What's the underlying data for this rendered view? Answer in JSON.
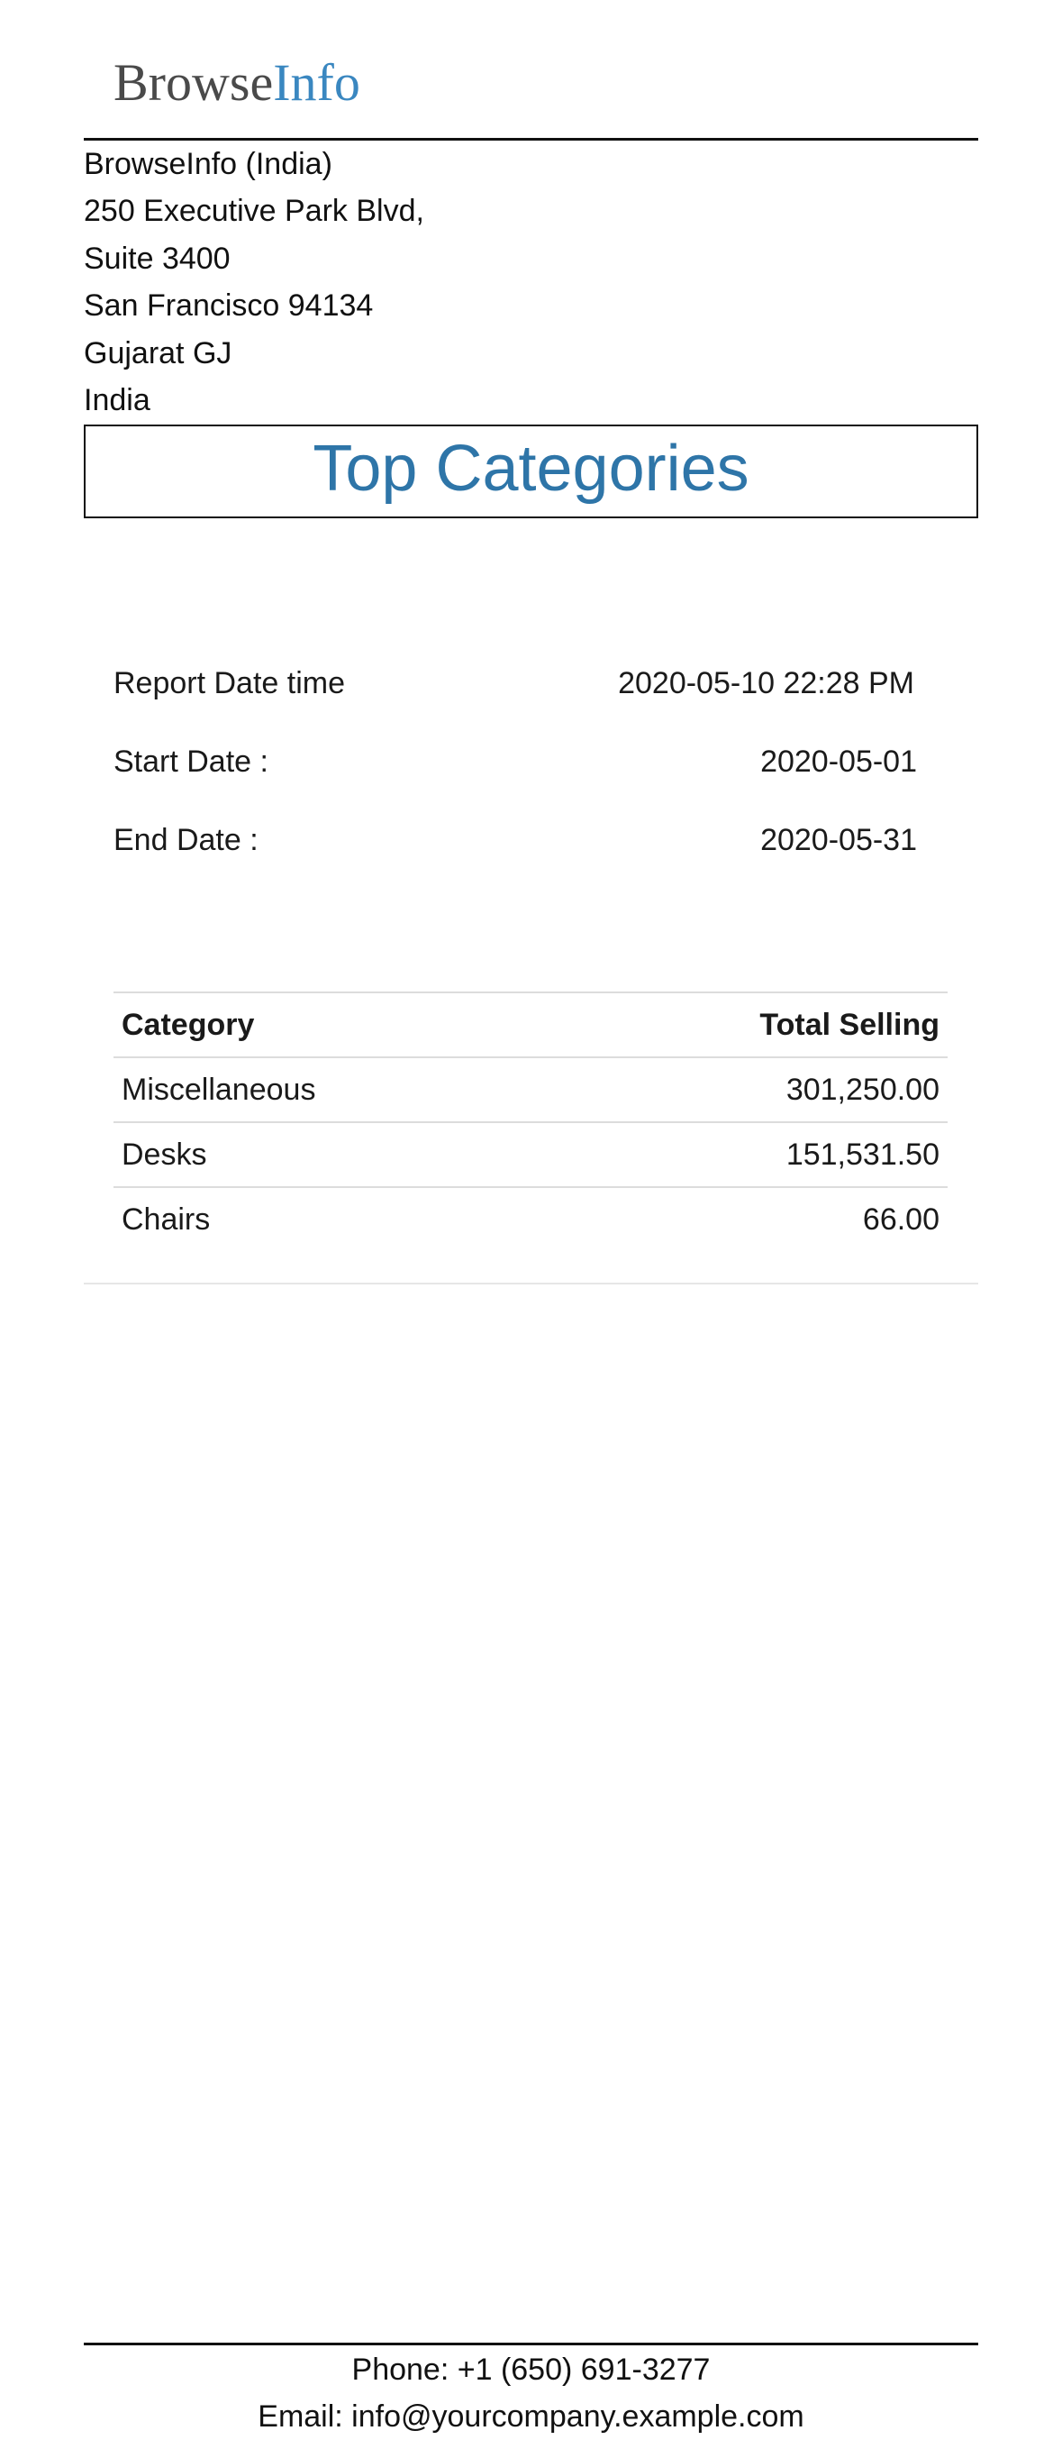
{
  "logo": {
    "part_a": "Browse",
    "part_b": "Info"
  },
  "company": {
    "lines": [
      "BrowseInfo (India)",
      "250 Executive Park Blvd,",
      "Suite 3400",
      "San Francisco 94134",
      "Gujarat GJ",
      "India"
    ]
  },
  "report": {
    "title": "Top Categories",
    "info": [
      {
        "label": "Report Date time",
        "value": "2020-05-10 22:28 PM"
      },
      {
        "label": "Start Date :",
        "value": "2020-05-01"
      },
      {
        "label": "End Date :",
        "value": "2020-05-31"
      }
    ]
  },
  "table": {
    "headers": [
      "Category",
      "Total Selling"
    ],
    "rows": [
      [
        "Miscellaneous",
        "301,250.00"
      ],
      [
        "Desks",
        "151,531.50"
      ],
      [
        "Chairs",
        "66.00"
      ]
    ]
  },
  "footer": {
    "phone": "Phone: +1 (650) 691-3277",
    "email": "Email: info@yourcompany.example.com"
  },
  "colors": {
    "logo_accent": "#3a87c0",
    "title": "#2e75a8"
  }
}
